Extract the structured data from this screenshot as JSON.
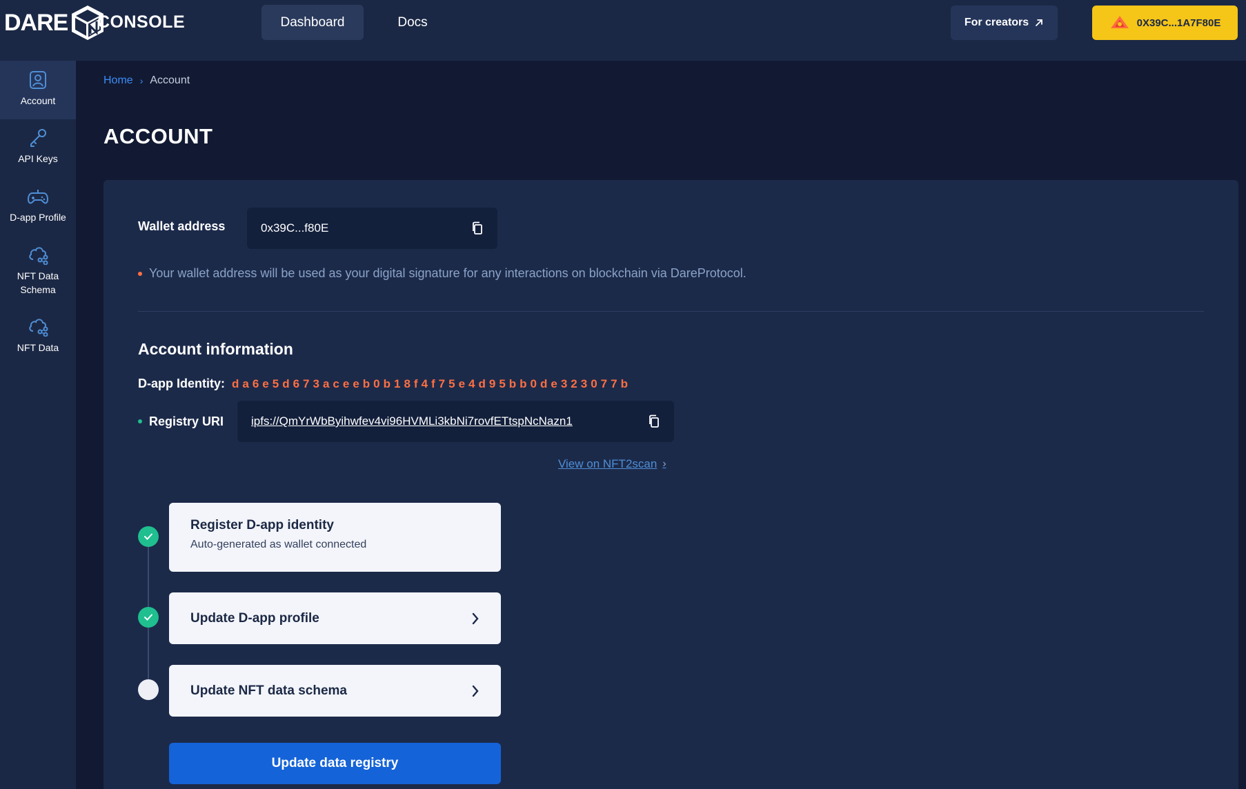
{
  "header": {
    "logo_text": "DARE",
    "console_title": "CONSOLE",
    "nav": [
      {
        "label": "Dashboard"
      },
      {
        "label": "Docs"
      }
    ],
    "creators_label": "For creators",
    "wallet_label": "0X39C...1A7F80E"
  },
  "sidebar": {
    "items": [
      {
        "label": "Account",
        "icon": "user-icon",
        "active": true
      },
      {
        "label": "API Keys",
        "icon": "key-icon"
      },
      {
        "label": "D-app Profile",
        "icon": "gamepad-icon"
      },
      {
        "label": "NFT Data Schema",
        "label_line1": "NFT Data",
        "label_line2": "Schema",
        "icon": "cloud-share-icon"
      },
      {
        "label": "NFT Data",
        "icon": "cloud-share-icon"
      }
    ]
  },
  "breadcrumb": {
    "home": "Home",
    "separator": "›",
    "current": "Account"
  },
  "page_title": "ACCOUNT",
  "wallet": {
    "label": "Wallet address",
    "value": "0x39C...f80E",
    "note": "Your wallet address will be used as your digital signature for any interactions on blockchain via DareProtocol."
  },
  "account_info": {
    "title": "Account information",
    "identity_label": "D-app Identity:",
    "identity_value": "da6e5d673aceeb0b18f4f75e4d95bb0de323077b",
    "registry_label": "Registry URI",
    "registry_value": "ipfs://QmYrWbByihwfev4vi96HVMLi3kbNi7rovfETtspNcNazn1",
    "view_link": "View on NFT2scan",
    "view_chevron": "›"
  },
  "steps": [
    {
      "title": "Register D-app identity",
      "subtitle": "Auto-generated as wallet connected",
      "status": "done"
    },
    {
      "title": "Update D-app profile",
      "status": "done",
      "chevron": "›"
    },
    {
      "title": "Update NFT data schema",
      "status": "pending",
      "chevron": "›"
    }
  ],
  "update_button": "Update data registry",
  "colors": {
    "background": "#121a33",
    "topbar": "#1b2845",
    "panel": "#1c2a4a",
    "accent_orange": "#ff7043",
    "accent_yellow": "#f5c518",
    "success_green": "#1fbf8f",
    "primary_blue": "#1463d8",
    "link_blue": "#3b8cf7"
  }
}
